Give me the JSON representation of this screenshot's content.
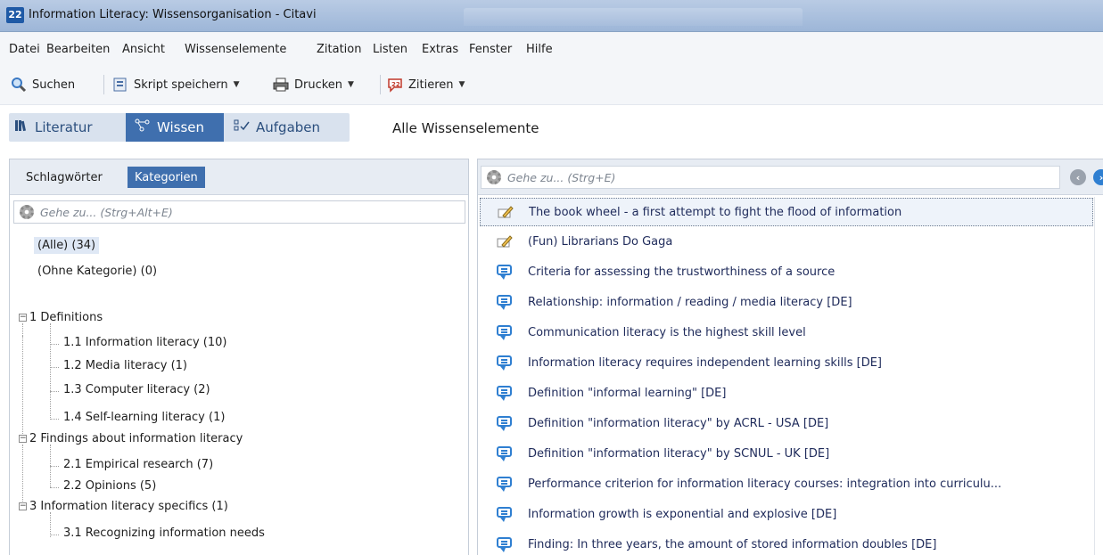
{
  "window": {
    "title": "Information Literacy: Wissensorganisation - Citavi"
  },
  "menu": [
    "Datei",
    "Bearbeiten",
    "Ansicht",
    "Wissenselemente",
    "Zitation",
    "Listen",
    "Extras",
    "Fenster",
    "Hilfe"
  ],
  "toolbar": {
    "search": "Suchen",
    "save_script": "Skript speichern",
    "print": "Drucken",
    "cite": "Zitieren"
  },
  "nav": {
    "literature": "Literatur",
    "knowledge": "Wissen",
    "tasks": "Aufgaben",
    "view_title": "Alle Wissenselemente"
  },
  "left": {
    "tabs": [
      "Schlagwörter",
      "Kategorien"
    ],
    "goto_placeholder": "Gehe zu... (Strg+Alt+E)",
    "tree": [
      {
        "label": "(Alle) (34)",
        "level": 0,
        "selected": true
      },
      {
        "label": "(Ohne Kategorie) (0)",
        "level": 0
      },
      {
        "label": "1 Definitions",
        "level": 0,
        "expander": "minus"
      },
      {
        "label": "1.1 Information literacy (10)",
        "level": 1
      },
      {
        "label": "1.2 Media literacy (1)",
        "level": 1
      },
      {
        "label": "1.3 Computer literacy (2)",
        "level": 1
      },
      {
        "label": "1.4 Self-learning literacy (1)",
        "level": 1
      },
      {
        "label": "2 Findings about information literacy",
        "level": 0,
        "expander": "minus"
      },
      {
        "label": "2.1 Empirical research (7)",
        "level": 1
      },
      {
        "label": "2.2 Opinions (5)",
        "level": 1
      },
      {
        "label": "3 Information literacy specifics (1)",
        "level": 0,
        "expander": "minus"
      },
      {
        "label": "3.1 Recognizing information needs",
        "level": 1
      }
    ]
  },
  "right": {
    "goto_placeholder": "Gehe zu... (Strg+E)",
    "items": [
      {
        "text": "The book wheel - a first attempt to fight the flood of information",
        "icon": "pencil-icon"
      },
      {
        "text": "(Fun) Librarians Do Gaga",
        "icon": "pencil-icon"
      },
      {
        "text": "Criteria for assessing the trustworthiness of a source",
        "icon": "comment-icon"
      },
      {
        "text": "Relationship: information / reading / media literacy [DE]",
        "icon": "comment-icon"
      },
      {
        "text": "Communication literacy is the highest skill level",
        "icon": "comment-icon"
      },
      {
        "text": "Information literacy requires independent learning skills [DE]",
        "icon": "comment-icon"
      },
      {
        "text": "Definition \"informal learning\" [DE]",
        "icon": "comment-icon"
      },
      {
        "text": "Definition \"information literacy\" by ACRL - USA [DE]",
        "icon": "comment-icon"
      },
      {
        "text": "Definition \"information literacy\" by SCNUL - UK [DE]",
        "icon": "comment-icon"
      },
      {
        "text": "Performance criterion for information literacy courses: integration into curriculu...",
        "icon": "comment-icon"
      },
      {
        "text": "Information growth is exponential and explosive [DE]",
        "icon": "comment-icon"
      },
      {
        "text": "Finding: In three years, the amount of stored information doubles [DE]",
        "icon": "comment-icon"
      }
    ]
  }
}
